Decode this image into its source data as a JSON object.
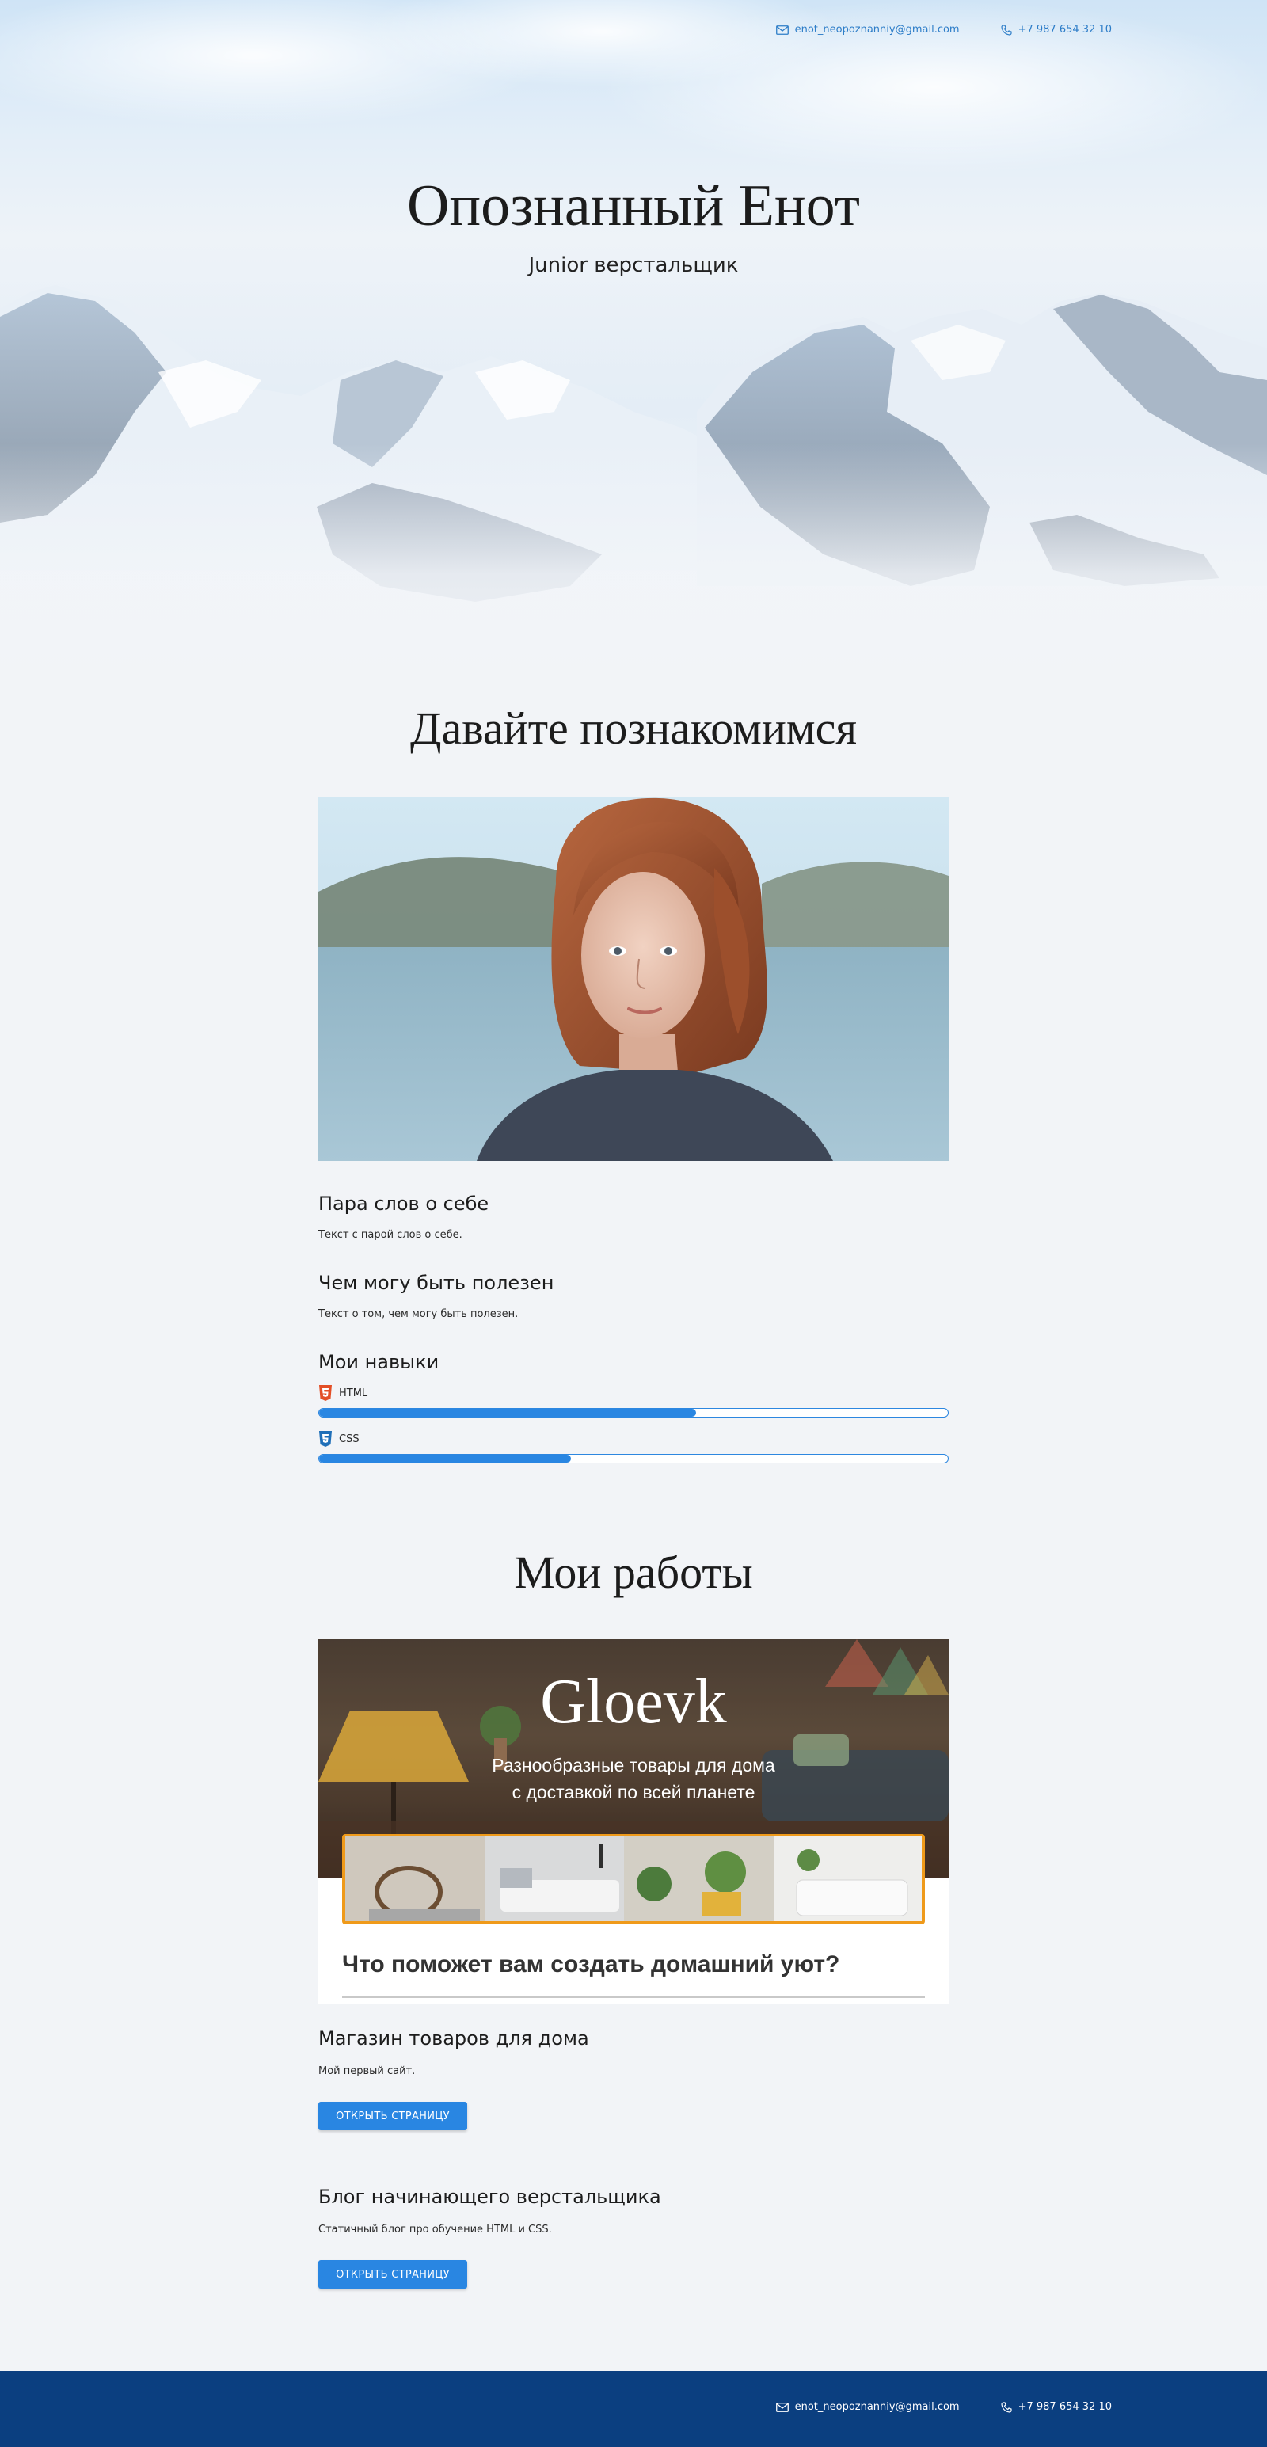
{
  "header": {
    "email": "enot_neopoznanniy@gmail.com",
    "phone": "+7 987 654 32 10"
  },
  "hero": {
    "title": "Опознанный Енот",
    "subtitle": "Junior верстальщик"
  },
  "about": {
    "title": "Давайте познакомимся",
    "sections": [
      {
        "heading": "Пара слов о себе",
        "text": "Текст с парой слов о себе."
      },
      {
        "heading": "Чем могу быть полезен",
        "text": "Текст о том, чем могу быть полезен."
      }
    ],
    "skills_heading": "Мои навыки",
    "skills": [
      {
        "name": "HTML",
        "level": 0.6,
        "icon": "html5-icon"
      },
      {
        "name": "CSS",
        "level": 0.4,
        "icon": "css3-icon"
      }
    ]
  },
  "works": {
    "title": "Мои работы",
    "preview": {
      "brand": "Gloevk",
      "tagline_line1": "Разнообразные товары для дома",
      "tagline_line2": "с доставкой по всей планете",
      "heading": "Что поможет вам создать домашний уют?"
    },
    "items": [
      {
        "title": "Магазин товаров для дома",
        "text": "Мой первый сайт.",
        "button": "ОТКРЫТЬ СТРАНИЦУ"
      },
      {
        "title": "Блог начинающего верстальщика",
        "text": "Статичный блог про обучение HTML и CSS.",
        "button": "ОТКРЫТЬ СТРАНИЦУ"
      }
    ]
  },
  "footer": {
    "email": "enot_neopoznanniy@gmail.com",
    "phone": "+7 987 654 32 10"
  },
  "colors": {
    "accent": "#2986e2",
    "footer": "#0b3f80",
    "background": "#f2f4f7",
    "html_icon": "#e34f26",
    "css_icon": "#1f6fb8"
  }
}
